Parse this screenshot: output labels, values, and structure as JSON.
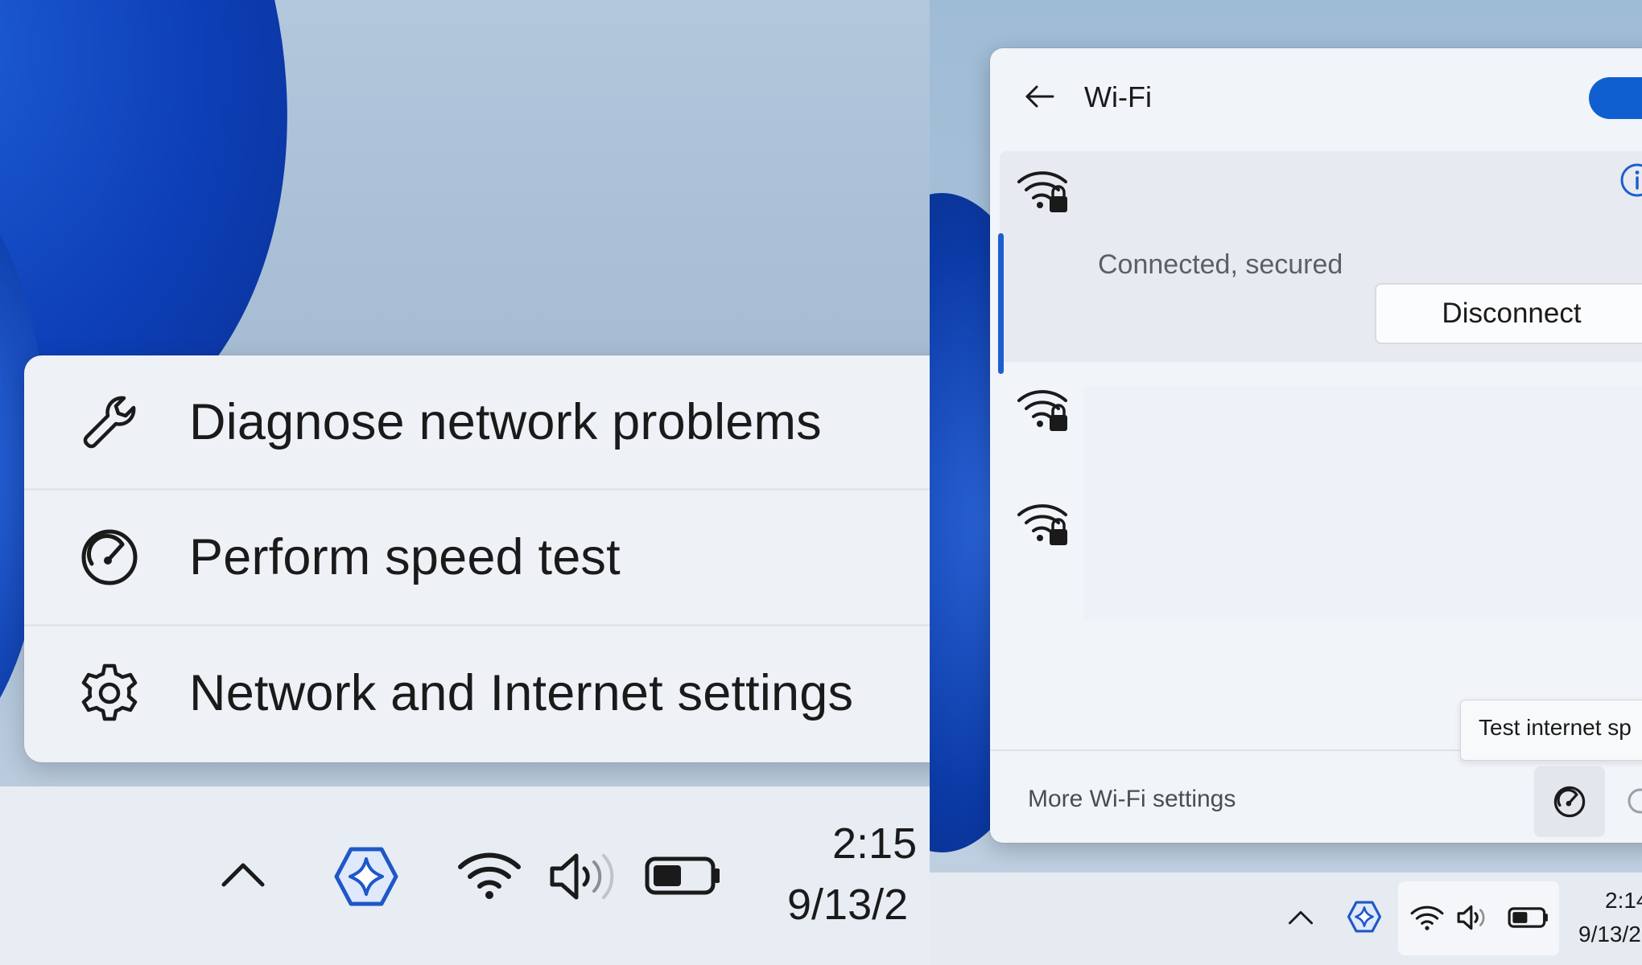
{
  "left_panel": {
    "context_menu": {
      "items": [
        {
          "label": "Diagnose network problems",
          "icon": "wrench-icon"
        },
        {
          "label": "Perform speed test",
          "icon": "speedometer-icon"
        },
        {
          "label": "Network and Internet settings",
          "icon": "gear-icon"
        }
      ]
    },
    "taskbar": {
      "icons": [
        "chevron-up-icon",
        "copilot-icon",
        "wifi-icon",
        "volume-icon",
        "battery-icon"
      ],
      "clock_time": "2:15",
      "clock_date": "9/13/2"
    }
  },
  "right_panel": {
    "wifi_flyout": {
      "title": "Wi-Fi",
      "toggle_on": true,
      "connected_network": {
        "status": "Connected, secured",
        "disconnect_label": "Disconnect"
      },
      "networks_secured": 3,
      "footer": {
        "more_settings_label": "More Wi-Fi settings"
      },
      "tooltip": "Test internet sp"
    },
    "taskbar": {
      "icons": [
        "chevron-up-icon",
        "copilot-icon",
        "wifi-icon",
        "volume-icon",
        "battery-icon"
      ],
      "clock_time": "2:14",
      "clock_date": "9/13/2"
    }
  },
  "colors": {
    "accent": "#0f5fd0",
    "menu_bg": "#eef1f5",
    "taskbar_bg": "#e8edf3"
  }
}
